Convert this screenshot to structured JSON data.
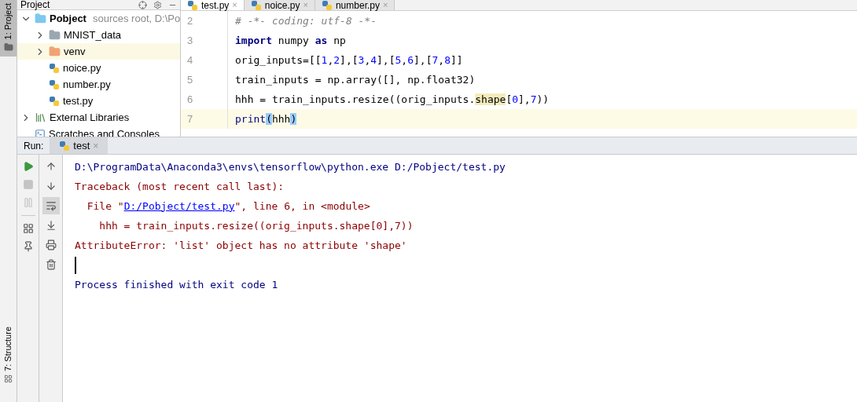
{
  "left_strip": {
    "top_label": "1: Project",
    "bottom_label": "7: Structure"
  },
  "project_panel": {
    "title": "Project",
    "tree": [
      {
        "label": "Pobject",
        "detail": "sources root,  D:\\Po",
        "kind": "root",
        "expanded": true,
        "selected": false,
        "children": [
          {
            "label": "MNIST_data",
            "kind": "folder",
            "expanded": false,
            "selected": false
          },
          {
            "label": "venv",
            "kind": "excluded",
            "expanded": false,
            "selected": true
          },
          {
            "label": "noice.py",
            "kind": "file",
            "selected": false
          },
          {
            "label": "number.py",
            "kind": "file",
            "selected": false
          },
          {
            "label": "test.py",
            "kind": "file",
            "selected": false
          }
        ]
      },
      {
        "label": "External Libraries",
        "kind": "libraries",
        "expanded": false,
        "selected": false
      },
      {
        "label": "Scratches and Consoles",
        "kind": "scratches",
        "selected": false
      }
    ]
  },
  "editor": {
    "tabs": [
      {
        "label": "test.py",
        "close": "×",
        "selected": true
      },
      {
        "label": "noice.py",
        "close": "×",
        "selected": false
      },
      {
        "label": "number.py",
        "close": "×",
        "selected": false
      }
    ],
    "lines": [
      {
        "number": "2",
        "current": false,
        "segments": [
          {
            "kind": "comment",
            "text": "# -*- coding: utf-8 -*-"
          }
        ]
      },
      {
        "number": "3",
        "current": false,
        "segments": [
          {
            "kind": "keyword",
            "text": "import"
          },
          {
            "kind": "plain",
            "text": " numpy "
          },
          {
            "kind": "keyword",
            "text": "as"
          },
          {
            "kind": "plain",
            "text": " np"
          }
        ]
      },
      {
        "number": "4",
        "current": false,
        "segments": [
          {
            "kind": "plain",
            "text": "orig_inputs=[["
          },
          {
            "kind": "number",
            "text": "1"
          },
          {
            "kind": "plain",
            "text": ","
          },
          {
            "kind": "number",
            "text": "2"
          },
          {
            "kind": "plain",
            "text": "],["
          },
          {
            "kind": "number",
            "text": "3"
          },
          {
            "kind": "plain",
            "text": ","
          },
          {
            "kind": "number",
            "text": "4"
          },
          {
            "kind": "plain",
            "text": "],["
          },
          {
            "kind": "number",
            "text": "5"
          },
          {
            "kind": "plain",
            "text": ","
          },
          {
            "kind": "number",
            "text": "6"
          },
          {
            "kind": "plain",
            "text": "],["
          },
          {
            "kind": "number",
            "text": "7"
          },
          {
            "kind": "plain",
            "text": ","
          },
          {
            "kind": "number",
            "text": "8"
          },
          {
            "kind": "plain",
            "text": "]]"
          }
        ]
      },
      {
        "number": "5",
        "current": false,
        "segments": [
          {
            "kind": "plain",
            "text": "train_inputs = np.array([], np.float32)"
          }
        ]
      },
      {
        "number": "6",
        "current": false,
        "segments": [
          {
            "kind": "plain",
            "text": "hhh = train_inputs.resize((orig_inputs."
          },
          {
            "kind": "warning",
            "text": "shape"
          },
          {
            "kind": "plain",
            "text": "["
          },
          {
            "kind": "number",
            "text": "0"
          },
          {
            "kind": "plain",
            "text": "],"
          },
          {
            "kind": "number",
            "text": "7"
          },
          {
            "kind": "plain",
            "text": "))"
          }
        ]
      },
      {
        "number": "7",
        "current": true,
        "segments": [
          {
            "kind": "builtin",
            "text": "print"
          },
          {
            "kind": "brace",
            "text": "("
          },
          {
            "kind": "plain",
            "text": "hhh"
          },
          {
            "kind": "brace",
            "text": ")"
          }
        ]
      }
    ]
  },
  "run_panel": {
    "label": "Run:",
    "tabs": [
      {
        "label": "test",
        "close": "×",
        "selected": true
      }
    ],
    "tools_left": [
      {
        "kind": "run",
        "disabled": false
      },
      {
        "kind": "stop",
        "disabled": true
      },
      {
        "kind": "pause",
        "disabled": true
      },
      {
        "kind": "layout",
        "disabled": false
      },
      {
        "kind": "pin",
        "disabled": false
      }
    ],
    "tools_right": [
      {
        "kind": "up",
        "selected": false
      },
      {
        "kind": "down",
        "selected": false
      },
      {
        "kind": "wrap",
        "selected": true
      },
      {
        "kind": "scroll-end",
        "selected": false
      },
      {
        "kind": "print",
        "selected": false
      },
      {
        "kind": "trash",
        "selected": false
      }
    ],
    "console": [
      {
        "kind": "command",
        "segments": [
          {
            "kind": "plain",
            "text": "D:\\ProgramData\\Anaconda3\\envs\\tensorflow\\python.exe D:/Pobject/test.py"
          }
        ]
      },
      {
        "kind": "error",
        "segments": [
          {
            "kind": "plain",
            "text": "Traceback (most recent call last):"
          }
        ]
      },
      {
        "kind": "error",
        "segments": [
          {
            "kind": "plain",
            "text": "  File \""
          },
          {
            "kind": "link",
            "text": "D:/Pobject/test.py"
          },
          {
            "kind": "plain",
            "text": "\", line 6, in <module>"
          }
        ]
      },
      {
        "kind": "error",
        "segments": [
          {
            "kind": "plain",
            "text": "    hhh = train_inputs.resize((orig_inputs.shape[0],7))"
          }
        ]
      },
      {
        "kind": "error",
        "segments": [
          {
            "kind": "plain",
            "text": "AttributeError: 'list' object has no attribute 'shape'"
          }
        ]
      },
      {
        "kind": "cursor"
      },
      {
        "kind": "command",
        "segments": [
          {
            "kind": "plain",
            "text": "Process finished with exit code 1"
          }
        ]
      }
    ]
  }
}
